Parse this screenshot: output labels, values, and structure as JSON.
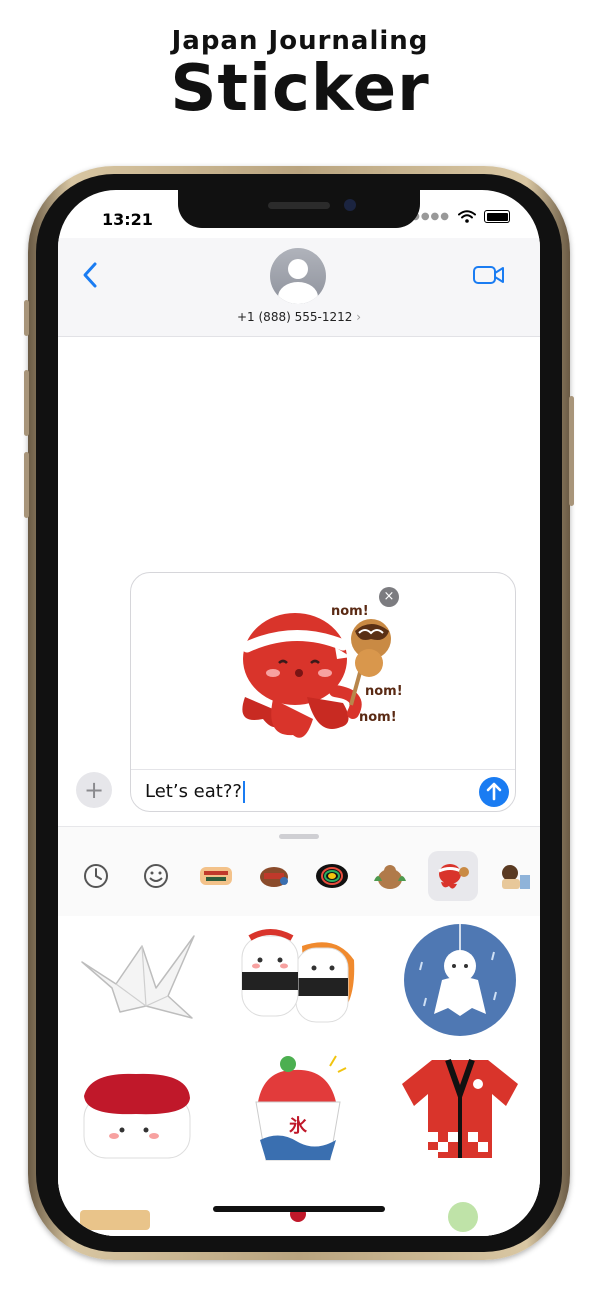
{
  "promo": {
    "subtitle": "Japan Journaling",
    "title": "Sticker"
  },
  "status_bar": {
    "time": "13:21",
    "signal_icon": "cellular-dots-icon",
    "wifi_icon": "wifi-icon",
    "battery_icon": "battery-icon"
  },
  "header": {
    "back_icon": "chevron-left-icon",
    "contact_number": "+1 (888) 555-1212",
    "contact_chevron": "›",
    "video_icon": "video-camera-icon"
  },
  "compose": {
    "attached_sticker": "octopus-takoyaki-sticker",
    "sticker_text_1": "nom!",
    "sticker_text_2": "nom!",
    "sticker_text_3": "nom!",
    "remove_label": "×",
    "message_text": "Let’s eat??",
    "plus_label": "+",
    "send_icon": "arrow-up-icon"
  },
  "sticker_tray": {
    "items": [
      {
        "name": "recents-clock-icon"
      },
      {
        "name": "emoji-icon"
      },
      {
        "name": "sticker-pack-1-icon"
      },
      {
        "name": "sticker-pack-2-icon"
      },
      {
        "name": "sticker-pack-3-icon"
      },
      {
        "name": "sticker-pack-4-icon"
      },
      {
        "name": "octopus-pack-icon",
        "selected": true
      },
      {
        "name": "sticker-pack-6-icon"
      }
    ]
  },
  "sticker_grid": {
    "stickers": [
      {
        "name": "paper-crane-sticker"
      },
      {
        "name": "sushi-pair-sticker"
      },
      {
        "name": "teru-teru-bozu-sticker"
      },
      {
        "name": "tuna-nigiri-sticker"
      },
      {
        "name": "kakigori-sticker",
        "label": "氷"
      },
      {
        "name": "happi-coat-sticker"
      }
    ]
  },
  "colors": {
    "accent": "#1a7cf2",
    "octopus_red": "#d9342b",
    "phone_frame": "#c9b48d"
  }
}
